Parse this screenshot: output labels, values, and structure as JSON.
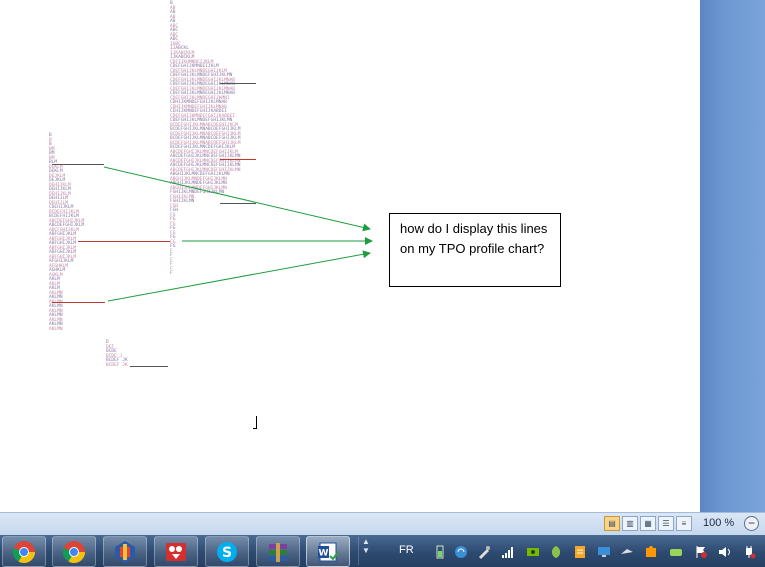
{
  "tpo_profile_right": [
    "B",
    "AB",
    "AB",
    "AB",
    "AB",
    "ABC",
    "ABC",
    "ABC",
    "ABC",
    "IABC",
    "IJABCKL",
    "IJKABCKLM",
    "IJKABCKLM",
    "CDFIJKHMNDEIJKLM",
    "CDEFGHIJKMNDEIJKLM",
    "CDEFGHIJKLMNDEGHIJKLM",
    "CDEFGHIJKLMNDEFGHIJKLMN",
    "CDEFGHIJKLMNDEGHIJKLMNAB",
    "CDEFGHIJKLMNDEGHIJKLMNAB",
    "CDEFGHIJKLMNDEGHIJKLMNAB",
    "CDEFGHIJKLMNDEGHIJKLMNAB",
    "CDEFGHIJKLMNDEGHIJKMNI",
    "CDHIJKMNDEFGHIJKLMNAB",
    "CDHIJKMNDEFGHIJKLMNAB",
    "CEHIJKMNDEFGHIJKABDEI",
    "CDEFGHIJKMNDEFGHIJKABDEI",
    "CDEFGHIJKLMNDEFGHIJKLMN",
    "BCDEFGHIJKLMNABCDEGHIJKLM",
    "BCDEFGHIJKLMNABCDEFGHIJKLM",
    "BCDEFGHIJKLMNABCDEFGHIJKLM",
    "BCDEFGHIJKLMNABCDEFGHIJKLM",
    "BCDEFGHIJKLMNABCDEFGHIJKLM",
    "BCDEFGHIJKLMNCDEFGHIJKLM",
    "ABCDEFGHIJKLMNCDEFGHIJKLM",
    "ABCDEFGHIJKLMNCDEFGHIJKLMN",
    "ABCDEFGHIJKLMNCDEFGHIJKLMN",
    "ABCDEFGHIJKLMNCDEFGHIJKLMN",
    "ABCDEFGHIJKLMNCDEFGHIJKLMN",
    "ABGHIJKLMNCDEFGHIJKLMN",
    "ABGHIJKLMNDEFGHIJKLMN",
    "ABGHIJKLMNDEFGHIJKLMN",
    "ABGHIJKLMNDEFGHIJKLMN",
    "FGHIJKLMNDEFGHIJKLMN",
    "FGHIJKLMN",
    "FGHIJKLMN",
    "FGH",
    "FGH",
    "FG",
    "FG",
    "FG",
    "FG",
    "FG",
    "FG",
    "FG",
    "FG",
    "F",
    "F",
    "F",
    "F",
    "F",
    "F"
  ],
  "tpo_profile_left": [
    "B",
    "B",
    "B",
    "BM",
    "BM",
    "BM",
    "BLM",
    "DEKLM",
    "DEKLM",
    "DEJKLM",
    "DEJKLM",
    "DEHIJKLM",
    "DEHIJKLM",
    "DEHIJKLM",
    "DEHIJLM",
    "DEHIJLM",
    "CDEHIJKLM",
    "BCDEFHIJKLM",
    "BCDEFHIJKLM",
    "ABCDEFGHIJKLM",
    "ABCDEFGHIJKLM",
    "ABCFGHIJKLM",
    "ABFGHIJKLM",
    "ABFGHIJKLM",
    "ABFGHIJKLM",
    "ABFGHIJKLM",
    "ABFGHIJKLM",
    "ABFGHIJKLM",
    "AFGHIJKLM",
    "AFGHKLM",
    "AGHKLM",
    "AGKLM",
    "AKLM",
    "AKLM",
    "AKLM",
    "AKLMN",
    "AKLMN",
    "AKLMN",
    "AKLMN",
    "AKLMN",
    "AKLMN",
    "AKLMN",
    "AKLMN",
    "AKLMN"
  ],
  "tpo_profile_small": [
    "D",
    "DEF",
    "BCDE",
    "BCDE J",
    "BCDEF JK",
    "BCDEF JK"
  ],
  "question": {
    "line1": "how do I display this lines",
    "line2": "on my TPO  profile chart?"
  },
  "statusbar": {
    "zoom_level": "100 %",
    "zoom_out": "−"
  },
  "taskbar": {
    "language": "FR",
    "apps": [
      "chrome-icon",
      "chrome-icon",
      "app-icon",
      "video-icon",
      "skype-icon",
      "winrar-icon",
      "word-icon"
    ]
  },
  "colors": {
    "connector_arrow": "#1e9e3c",
    "value_line_red": "#c0392b",
    "value_line_dark": "#555555",
    "taskbar": "#2d4a70",
    "right_panel": "#6e98d2"
  }
}
